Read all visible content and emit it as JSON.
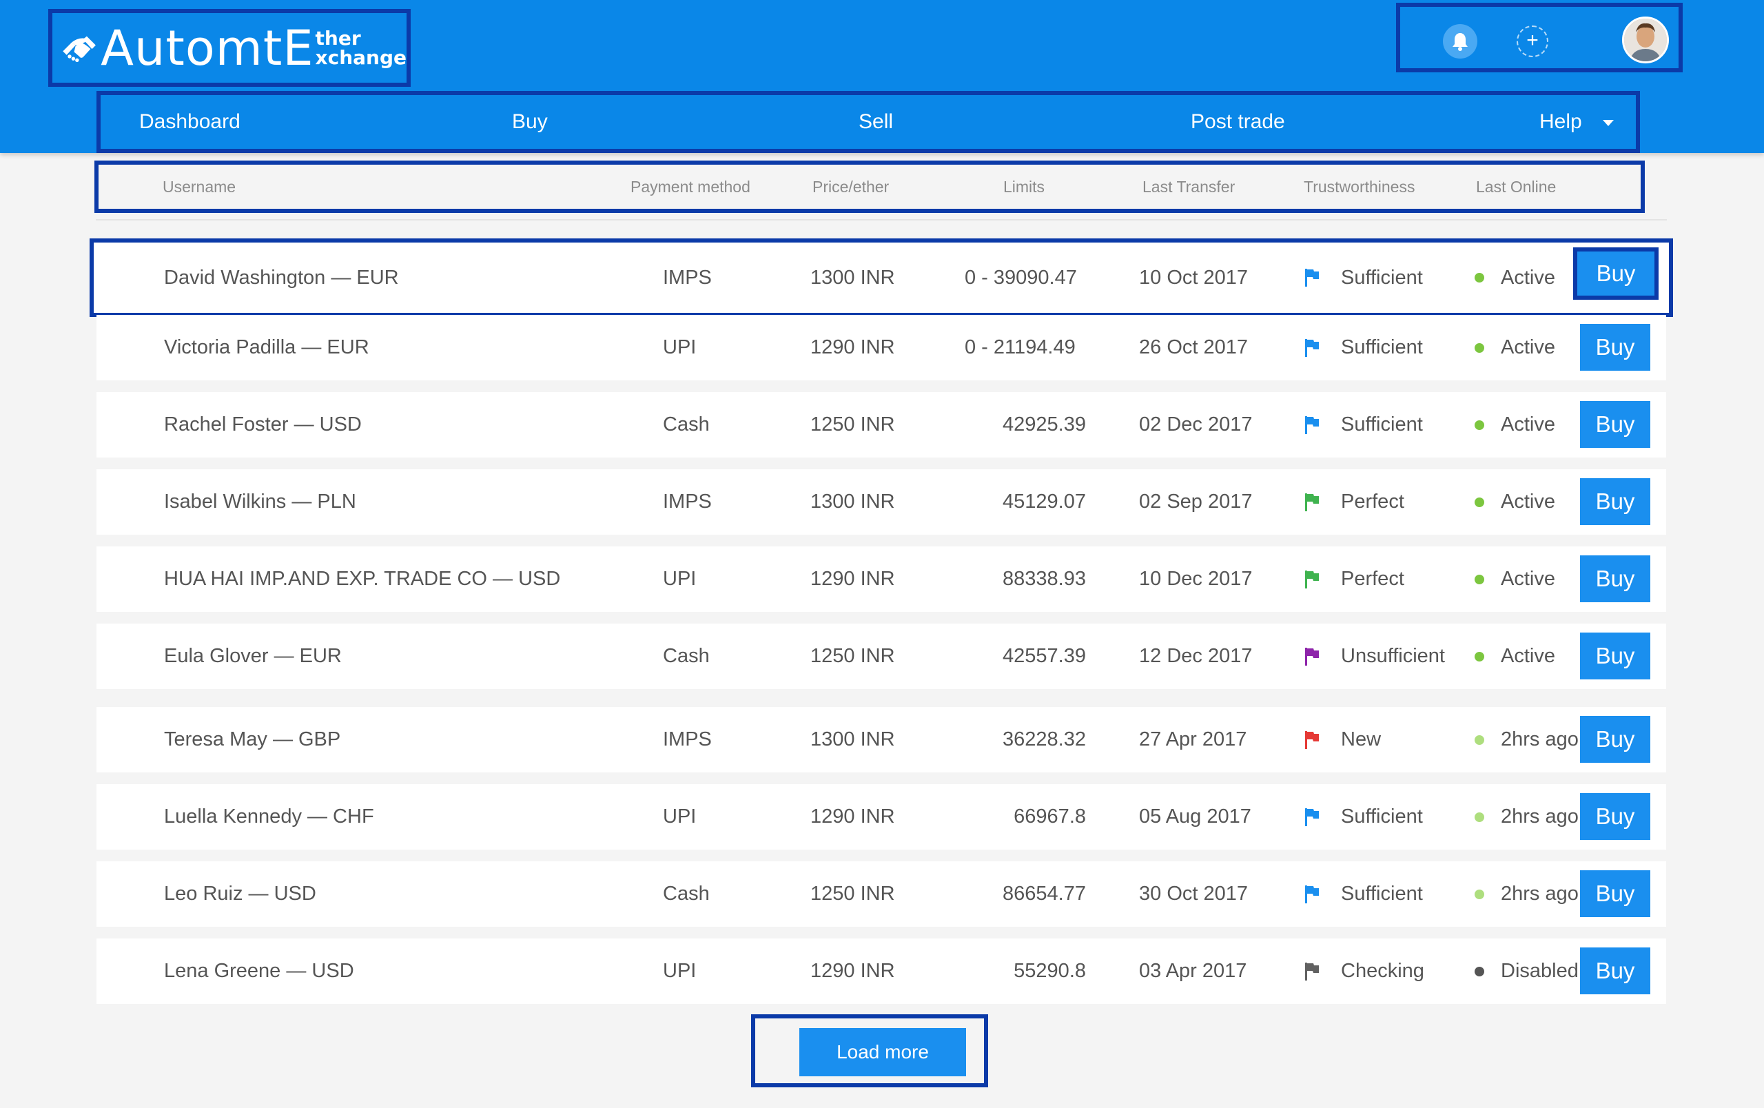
{
  "app": {
    "logo_main": "AutomtE",
    "logo_sup": "ther",
    "logo_sub": "xchange"
  },
  "nav": {
    "items": [
      {
        "label": "Dashboard"
      },
      {
        "label": "Buy"
      },
      {
        "label": "Sell"
      },
      {
        "label": "Post trade"
      },
      {
        "label": "Help"
      }
    ]
  },
  "header_actions": {
    "plus_symbol": "+",
    "bell_icon": "bell-icon",
    "avatar_icon": "user-avatar"
  },
  "table": {
    "columns": [
      "Username",
      "Payment method",
      "Price/ether",
      "Limits",
      "Last Transfer",
      "Trustworthiness",
      "Last Online"
    ],
    "buy_label": "Buy",
    "rows": [
      {
        "username": "David Washington — EUR",
        "payment": "IMPS",
        "price": "1300 INR",
        "limits": "0 - 39090.47",
        "last_transfer": "10 Oct 2017",
        "trust": "Sufficient",
        "trust_color": "#1a8fef",
        "online": "Active",
        "online_color": "#7cc63f"
      },
      {
        "username": "Victoria Padilla — EUR",
        "payment": "UPI",
        "price": "1290 INR",
        "limits": "0 - 21194.49",
        "last_transfer": "26 Oct 2017",
        "trust": "Sufficient",
        "trust_color": "#1a8fef",
        "online": "Active",
        "online_color": "#7cc63f"
      },
      {
        "username": "Rachel Foster — USD",
        "payment": "Cash",
        "price": "1250 INR",
        "limits": "42925.39",
        "last_transfer": "02 Dec 2017",
        "trust": "Sufficient",
        "trust_color": "#1a8fef",
        "online": "Active",
        "online_color": "#7cc63f"
      },
      {
        "username": "Isabel Wilkins — PLN",
        "payment": "IMPS",
        "price": "1300 INR",
        "limits": "45129.07",
        "last_transfer": "02 Sep 2017",
        "trust": "Perfect",
        "trust_color": "#3fb34f",
        "online": "Active",
        "online_color": "#7cc63f"
      },
      {
        "username": "HUA HAI IMP.AND EXP. TRADE CO — USD",
        "payment": "UPI",
        "price": "1290 INR",
        "limits": "88338.93",
        "last_transfer": "10 Dec 2017",
        "trust": "Perfect",
        "trust_color": "#3fb34f",
        "online": "Active",
        "online_color": "#7cc63f"
      },
      {
        "username": "Eula Glover — EUR",
        "payment": "Cash",
        "price": "1250 INR",
        "limits": "42557.39",
        "last_transfer": "12 Dec 2017",
        "trust": "Unsufficient",
        "trust_color": "#8e24aa",
        "online": "Active",
        "online_color": "#7cc63f"
      },
      {
        "username": "Teresa May — GBP",
        "payment": "IMPS",
        "price": "1300 INR",
        "limits": "36228.32",
        "last_transfer": "27 Apr 2017",
        "trust": "New",
        "trust_color": "#e53935",
        "online": "2hrs ago",
        "online_color": "#aede7e"
      },
      {
        "username": "Luella Kennedy — CHF",
        "payment": "UPI",
        "price": "1290 INR",
        "limits": "66967.8",
        "last_transfer": "05 Aug 2017",
        "trust": "Sufficient",
        "trust_color": "#1a8fef",
        "online": "2hrs ago",
        "online_color": "#aede7e"
      },
      {
        "username": "Leo Ruiz — USD",
        "payment": "Cash",
        "price": "1250 INR",
        "limits": "86654.77",
        "last_transfer": "30 Oct 2017",
        "trust": "Sufficient",
        "trust_color": "#1a8fef",
        "online": "2hrs ago",
        "online_color": "#aede7e"
      },
      {
        "username": "Lena Greene — USD",
        "payment": "UPI",
        "price": "1290 INR",
        "limits": "55290.8",
        "last_transfer": "03 Apr 2017",
        "trust": "Checking",
        "trust_color": "#616161",
        "online": "Disabled",
        "online_color": "#555555"
      }
    ]
  },
  "load_more": {
    "label": "Load more"
  },
  "colors": {
    "header_bg": "#0a87e8",
    "button_bg": "#1a8fef",
    "highlight_border": "#0b3aa8"
  }
}
